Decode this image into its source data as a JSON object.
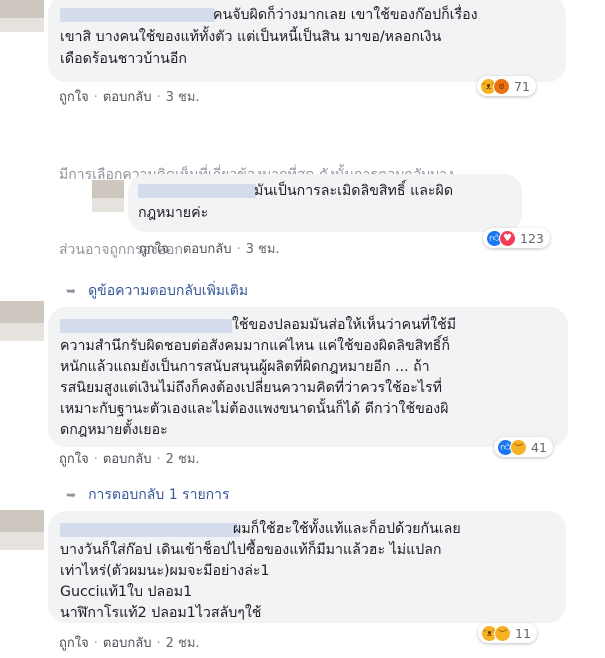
{
  "comments": [
    {
      "lines": [
        "คนจับผิดก็ว่างมากเลย เขาใช้ของก๊อปก็เรื่อง",
        "เขาสิ บางคนใช้ของแท้ทั้งตัว แต่เป็นหนี้เป็นสิน มาขอ/หลอกเงิน",
        "เดือดร้อนชาวบ้านอีก"
      ],
      "like": "ถูกใจ",
      "reply": "ตอบกลับ",
      "time": "3 ชม.",
      "reactions": [
        "haha-icon",
        "angry-icon"
      ],
      "count": "71"
    },
    {
      "lines": [
        "มันเป็นการละเมิดลิขสิทธิ์ และผิด",
        "กฎหมายค่ะ"
      ],
      "like": "ถูกใจ",
      "reply": "ตอบกลับ",
      "time": "3 ชม.",
      "reactions": [
        "like-icon",
        "love-icon"
      ],
      "count": "123"
    },
    {
      "lines": [
        "ใช้ของปลอมมันส่อให้เห็นว่าคนที่ใช้มี",
        "ความสำนึกรับผิดชอบต่อสังคมมากแค่ไหน แค่ใช้ของผิดลิขสิทธิ์ก็",
        "หนักแล้วแถมยังเป็นการสนับสนุนผู้ผลิตที่ผิดกฎหมายอีก ... ถ้า",
        "รสนิยมสูงแต่เงินไม่ถึงก็คงต้องเปลี่ยนความคิดที่ว่าควรใช้อะไรที่",
        "เหมาะกับฐานะตัวเองและไม่ต้องแพงขนาดนั้นก็ได้ ดีกว่าใช้ของผิ",
        "ดกฎหมายตั้งเยอะ"
      ],
      "like": "ถูกใจ",
      "reply": "ตอบกลับ",
      "time": "2 ชม.",
      "reactions": [
        "like-icon",
        "sad-icon"
      ],
      "count": "41"
    },
    {
      "lines": [
        "ผมก็ใช้ฮะใช้ทั้งแท้และก็อปด้วยกันเลย",
        "บางวันก็ใส่ก๊อป เดินเข้าช็อปไปซื้อของแท้ก็มีมาแล้วฮะ ไม่แปลก",
        "เท่าไหร่(ตัวผมนะ)ผมจะมีอย่างล่ะ1",
        "Gucciแท้1ใบ ปลอม1",
        "นาฬิกาโรแท้2 ปลอม1ไวสลับๆใช้"
      ],
      "like": "ถูกใจ",
      "reply": "ตอบกลับ",
      "time": "2 ชม.",
      "reactions": [
        "haha-icon",
        "sad-icon"
      ],
      "count": "11"
    }
  ],
  "notice": [
    "มีการเลือกความคิดเห็นที่เกี่ยวข้องมากที่สุด ดังนั้นการตอบกลับบาง",
    "ส่วนอาจถูกกรองออก"
  ],
  "more_replies": "ดูข้อความตอบกลับเพิ่มเติม",
  "replies_count": "การตอบกลับ 1 รายการ"
}
